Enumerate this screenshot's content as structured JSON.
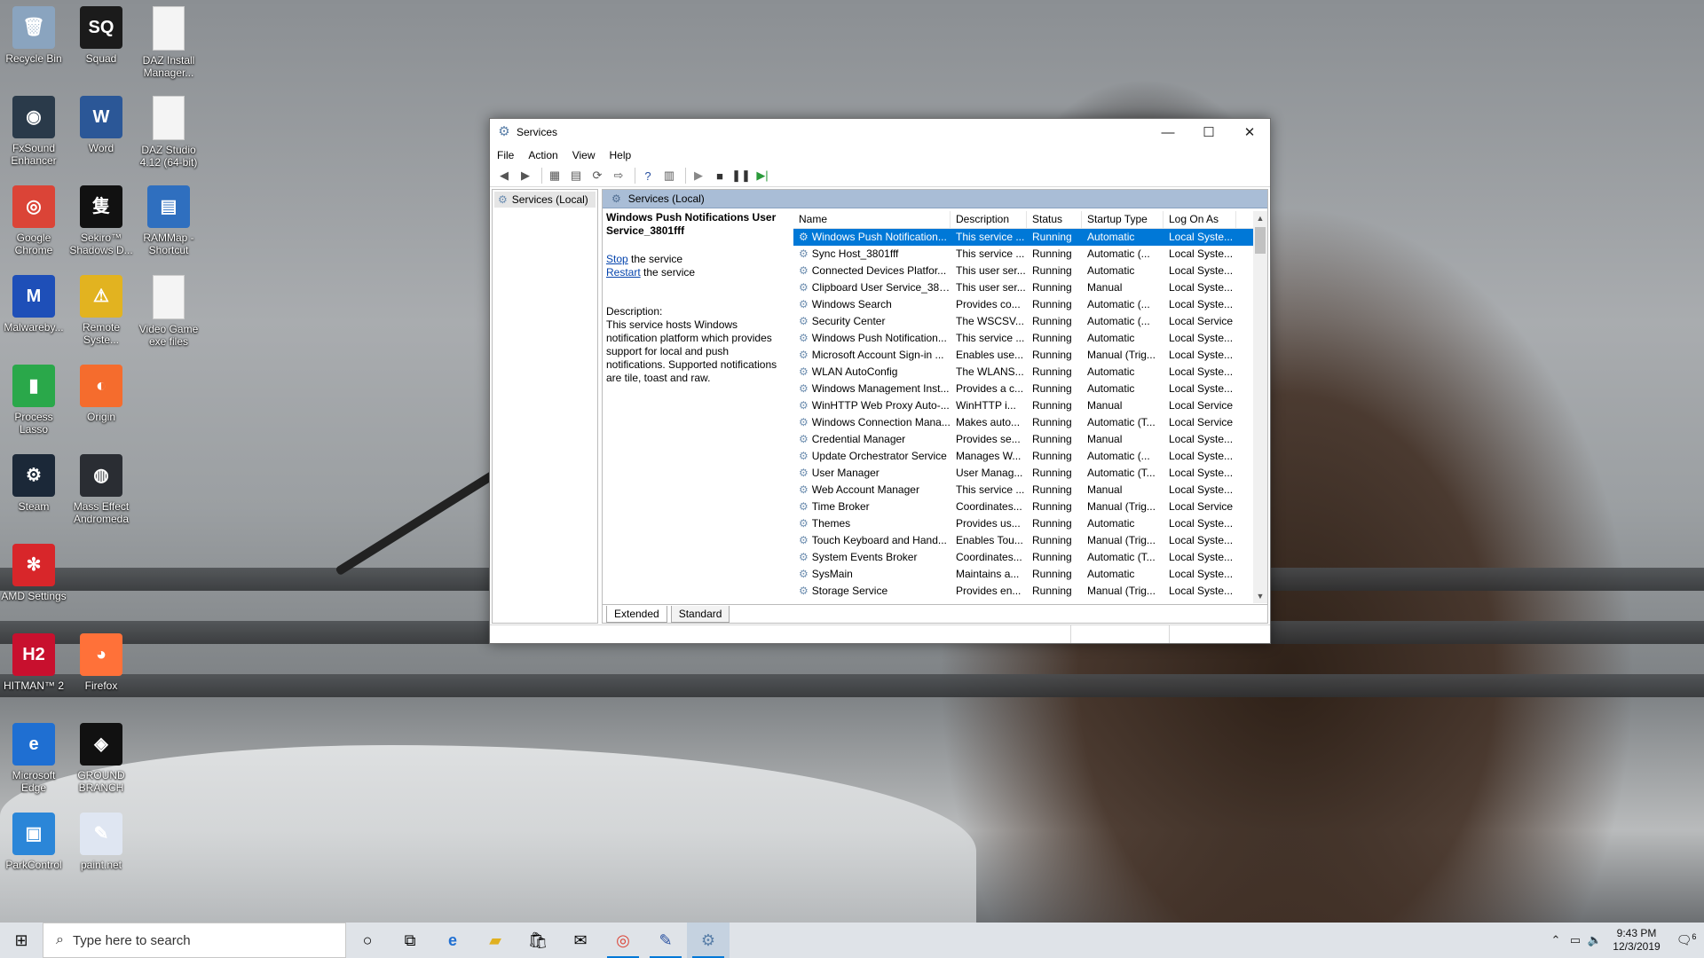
{
  "desktop": {
    "icons": [
      {
        "label": "Recycle Bin",
        "icon": "recycle-bin-icon",
        "color": "#8aa4bf",
        "glyph": "🗑"
      },
      {
        "label": "Squad",
        "icon": "squad-icon",
        "color": "#1b1b1b",
        "glyph": "SQ"
      },
      {
        "label": "DAZ Install Manager...",
        "icon": "file-icon",
        "color": "#f4f4f4",
        "glyph": ""
      },
      {
        "label": "FxSound Enhancer",
        "icon": "fxsound-icon",
        "color": "#2a3a4a",
        "glyph": "◉"
      },
      {
        "label": "Word",
        "icon": "word-icon",
        "color": "#2b5797",
        "glyph": "W"
      },
      {
        "label": "DAZ Studio 4.12 (64-bit)",
        "icon": "file-icon",
        "color": "#f4f4f4",
        "glyph": ""
      },
      {
        "label": "Google Chrome",
        "icon": "chrome-icon",
        "color": "#db4437",
        "glyph": "◎"
      },
      {
        "label": "Sekiro™ Shadows D...",
        "icon": "sekiro-icon",
        "color": "#111111",
        "glyph": "隻"
      },
      {
        "label": "RAMMap - Shortcut",
        "icon": "rammap-icon",
        "color": "#2f6fbf",
        "glyph": "▤"
      },
      {
        "label": "Malwareby...",
        "icon": "malwarebytes-icon",
        "color": "#1e4fb8",
        "glyph": "M"
      },
      {
        "label": "Remote Syste...",
        "icon": "remote-system-icon",
        "color": "#e2b320",
        "glyph": "⚠"
      },
      {
        "label": "Video Game exe files",
        "icon": "file-icon",
        "color": "#f4f4f4",
        "glyph": ""
      },
      {
        "label": "Process Lasso",
        "icon": "process-lasso-icon",
        "color": "#2aa84a",
        "glyph": "▮"
      },
      {
        "label": "Origin",
        "icon": "origin-icon",
        "color": "#f56c2d",
        "glyph": "◐"
      },
      {
        "label": "Steam",
        "icon": "steam-icon",
        "color": "#1b2838",
        "glyph": "⚙"
      },
      {
        "label": "Mass Effect Andromeda",
        "icon": "mass-effect-icon",
        "color": "#2a2d33",
        "glyph": "◍"
      },
      {
        "label": "AMD Settings",
        "icon": "amd-settings-icon",
        "color": "#d8262a",
        "glyph": "✻"
      },
      {
        "label": "HITMAN™ 2",
        "icon": "hitman-icon",
        "color": "#c8102e",
        "glyph": "H2"
      },
      {
        "label": "Firefox",
        "icon": "firefox-icon",
        "color": "#ff7139",
        "glyph": "◕"
      },
      {
        "label": "Microsoft Edge",
        "icon": "edge-icon",
        "color": "#1f6fd2",
        "glyph": "e"
      },
      {
        "label": "GROUND BRANCH",
        "icon": "ground-branch-icon",
        "color": "#111111",
        "glyph": "◈"
      },
      {
        "label": "ParkControl",
        "icon": "parkcontrol-icon",
        "color": "#2b86d8",
        "glyph": "▣"
      },
      {
        "label": "paint.net",
        "icon": "paintnet-icon",
        "color": "#dfe6f2",
        "glyph": "✎"
      }
    ]
  },
  "window": {
    "title": "Services",
    "menu": [
      "File",
      "Action",
      "View",
      "Help"
    ],
    "tree_root": "Services (Local)",
    "pane_header": "Services (Local)",
    "selected_service": "Windows Push Notifications User Service_3801fff",
    "stop_link": "Stop",
    "stop_suffix": " the service",
    "restart_link": "Restart",
    "restart_suffix": " the service",
    "description_label": "Description:",
    "description_text": "This service hosts Windows notification platform which provides support for local and push notifications. Supported notifications are tile, toast and raw.",
    "columns": [
      "Name",
      "Description",
      "Status",
      "Startup Type",
      "Log On As"
    ],
    "rows": [
      [
        "Windows Push Notification...",
        "This service ...",
        "Running",
        "Automatic",
        "Local Syste..."
      ],
      [
        "Sync Host_3801fff",
        "This service ...",
        "Running",
        "Automatic (...",
        "Local Syste..."
      ],
      [
        "Connected Devices Platfor...",
        "This user ser...",
        "Running",
        "Automatic",
        "Local Syste..."
      ],
      [
        "Clipboard User Service_3801...",
        "This user ser...",
        "Running",
        "Manual",
        "Local Syste..."
      ],
      [
        "Windows Search",
        "Provides co...",
        "Running",
        "Automatic (...",
        "Local Syste..."
      ],
      [
        "Security Center",
        "The WSCSV...",
        "Running",
        "Automatic (...",
        "Local Service"
      ],
      [
        "Windows Push Notification...",
        "This service ...",
        "Running",
        "Automatic",
        "Local Syste..."
      ],
      [
        "Microsoft Account Sign-in ...",
        "Enables use...",
        "Running",
        "Manual (Trig...",
        "Local Syste..."
      ],
      [
        "WLAN AutoConfig",
        "The WLANS...",
        "Running",
        "Automatic",
        "Local Syste..."
      ],
      [
        "Windows Management Inst...",
        "Provides a c...",
        "Running",
        "Automatic",
        "Local Syste..."
      ],
      [
        "WinHTTP Web Proxy Auto-...",
        "WinHTTP i...",
        "Running",
        "Manual",
        "Local Service"
      ],
      [
        "Windows Connection Mana...",
        "Makes auto...",
        "Running",
        "Automatic (T...",
        "Local Service"
      ],
      [
        "Credential Manager",
        "Provides se...",
        "Running",
        "Manual",
        "Local Syste..."
      ],
      [
        "Update Orchestrator Service",
        "Manages W...",
        "Running",
        "Automatic (...",
        "Local Syste..."
      ],
      [
        "User Manager",
        "User Manag...",
        "Running",
        "Automatic (T...",
        "Local Syste..."
      ],
      [
        "Web Account Manager",
        "This service ...",
        "Running",
        "Manual",
        "Local Syste..."
      ],
      [
        "Time Broker",
        "Coordinates...",
        "Running",
        "Manual (Trig...",
        "Local Service"
      ],
      [
        "Themes",
        "Provides us...",
        "Running",
        "Automatic",
        "Local Syste..."
      ],
      [
        "Touch Keyboard and Hand...",
        "Enables Tou...",
        "Running",
        "Manual (Trig...",
        "Local Syste..."
      ],
      [
        "System Events Broker",
        "Coordinates...",
        "Running",
        "Automatic (T...",
        "Local Syste..."
      ],
      [
        "SysMain",
        "Maintains a...",
        "Running",
        "Automatic",
        "Local Syste..."
      ],
      [
        "Storage Service",
        "Provides en...",
        "Running",
        "Manual (Trig...",
        "Local Syste..."
      ]
    ],
    "tabs": [
      "Extended",
      "Standard"
    ]
  },
  "taskbar": {
    "search_placeholder": "Type here to search",
    "time": "9:43 PM",
    "date": "12/3/2019",
    "notification_count": "6"
  },
  "colors": {
    "selection": "#0078d7",
    "pane_header": "#a9bdd6"
  }
}
